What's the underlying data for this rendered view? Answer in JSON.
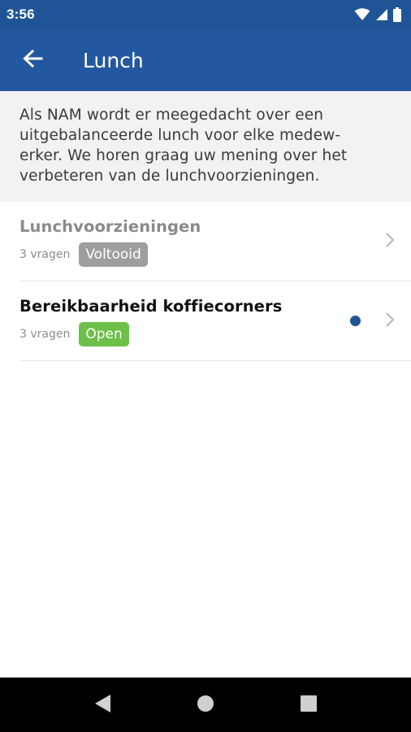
{
  "status_bar": {
    "time": "3:56",
    "icons": [
      "wifi-icon",
      "cellular-signal-icon",
      "battery-icon"
    ]
  },
  "app_bar": {
    "title": "Lunch",
    "back_icon": "arrow-left-icon"
  },
  "intro": {
    "lines": [
      "Als NAM wordt er meegedacht over een",
      "uitgebalanceerde lunch voor elke medew-",
      "erker. We horen graag uw mening over het",
      "verbeteren van de lunchvoorzieningen."
    ]
  },
  "surveys": [
    {
      "title": "Lunchvoorzieningen",
      "count": "3 vragen",
      "status": "Voltooid",
      "status_color": "#9e9e9e",
      "title_color": "#8a8a8a",
      "unread": false
    },
    {
      "title": "Bereikbaarheid koffiecorners",
      "count": "3 vragen",
      "status": "Open",
      "status_color": "#6cc04a",
      "title_color": "#111111",
      "unread": true
    }
  ],
  "nav_bar": {
    "buttons": [
      "back-triangle-icon",
      "home-circle-icon",
      "recents-square-icon"
    ]
  },
  "colors": {
    "primary": "#2358a0",
    "status_bar": "#1f5596",
    "intro_background": "#f2f2f2",
    "unread_dot": "#1f5596"
  }
}
